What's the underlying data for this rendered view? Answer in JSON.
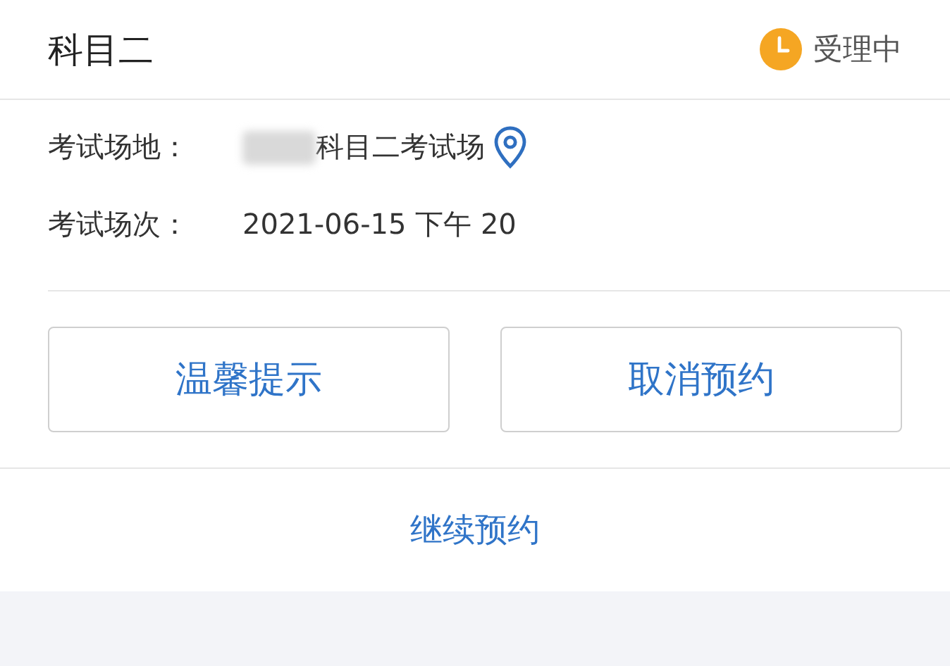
{
  "header": {
    "title": "科目二",
    "status": "受理中"
  },
  "fields": [
    {
      "label": "考试场地：",
      "value": "科目二考试场",
      "kind": "location"
    },
    {
      "label": "考试场次：",
      "value": "2021-06-15 下午 20",
      "kind": "plain"
    }
  ],
  "buttons": [
    "温馨提示",
    "取消预约"
  ],
  "footer_link": "继续预约"
}
